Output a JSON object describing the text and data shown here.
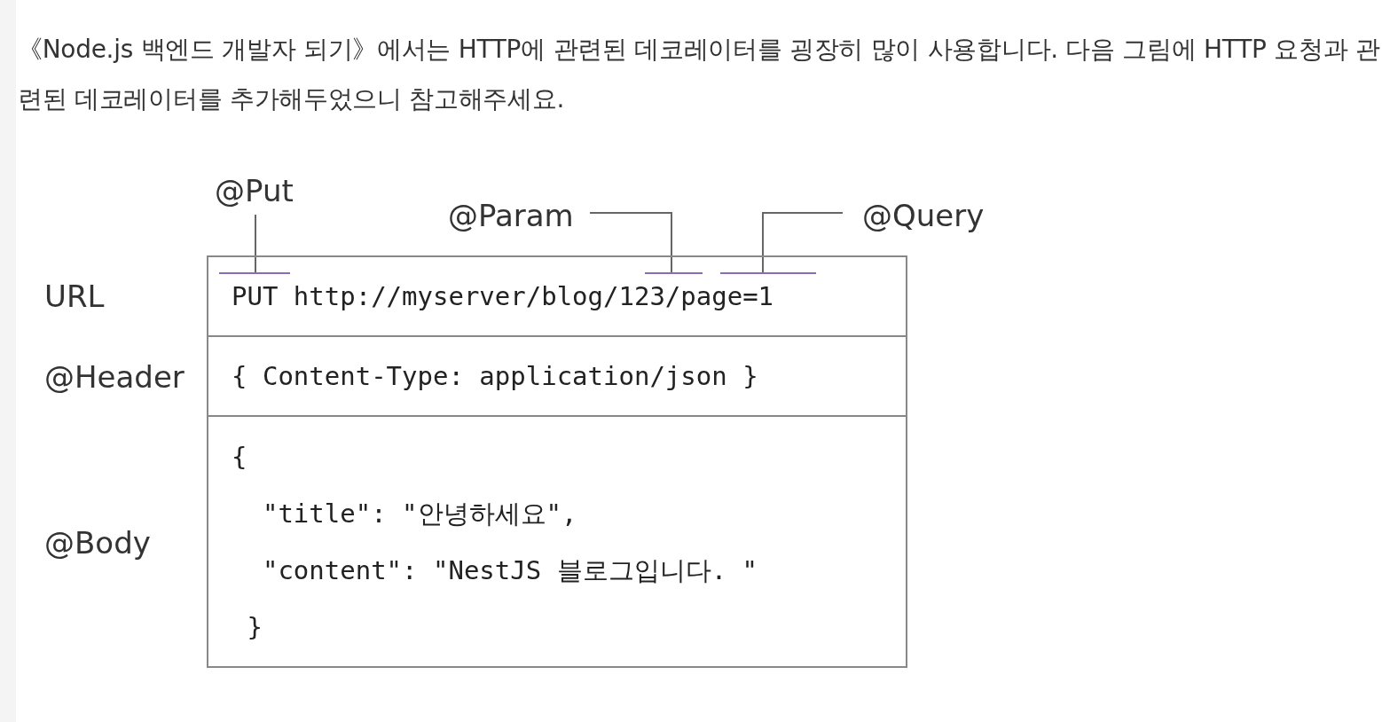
{
  "paragraph": "《Node.js 백엔드 개발자 되기》에서는 HTTP에 관련된 데코레이터를 굉장히 많이 사용합니다. 다음 그림에 HTTP 요청과 관련된 데코레이터를 추가해두었으니 참고해주세요.",
  "diagram": {
    "annotations": [
      {
        "label": "@Put"
      },
      {
        "label": "@Param"
      },
      {
        "label": "@Query"
      }
    ],
    "rows": [
      {
        "label": "URL",
        "lines": [
          "PUT http://myserver/blog/123/page=1"
        ]
      },
      {
        "label": "@Header",
        "lines": [
          "{ Content-Type: application/json }"
        ]
      },
      {
        "label": "@Body",
        "lines": [
          "{",
          "  \"title\": \"안녕하세요\",",
          "  \"content\": \"NestJS 블로그입니다. \"",
          " }"
        ]
      }
    ]
  }
}
